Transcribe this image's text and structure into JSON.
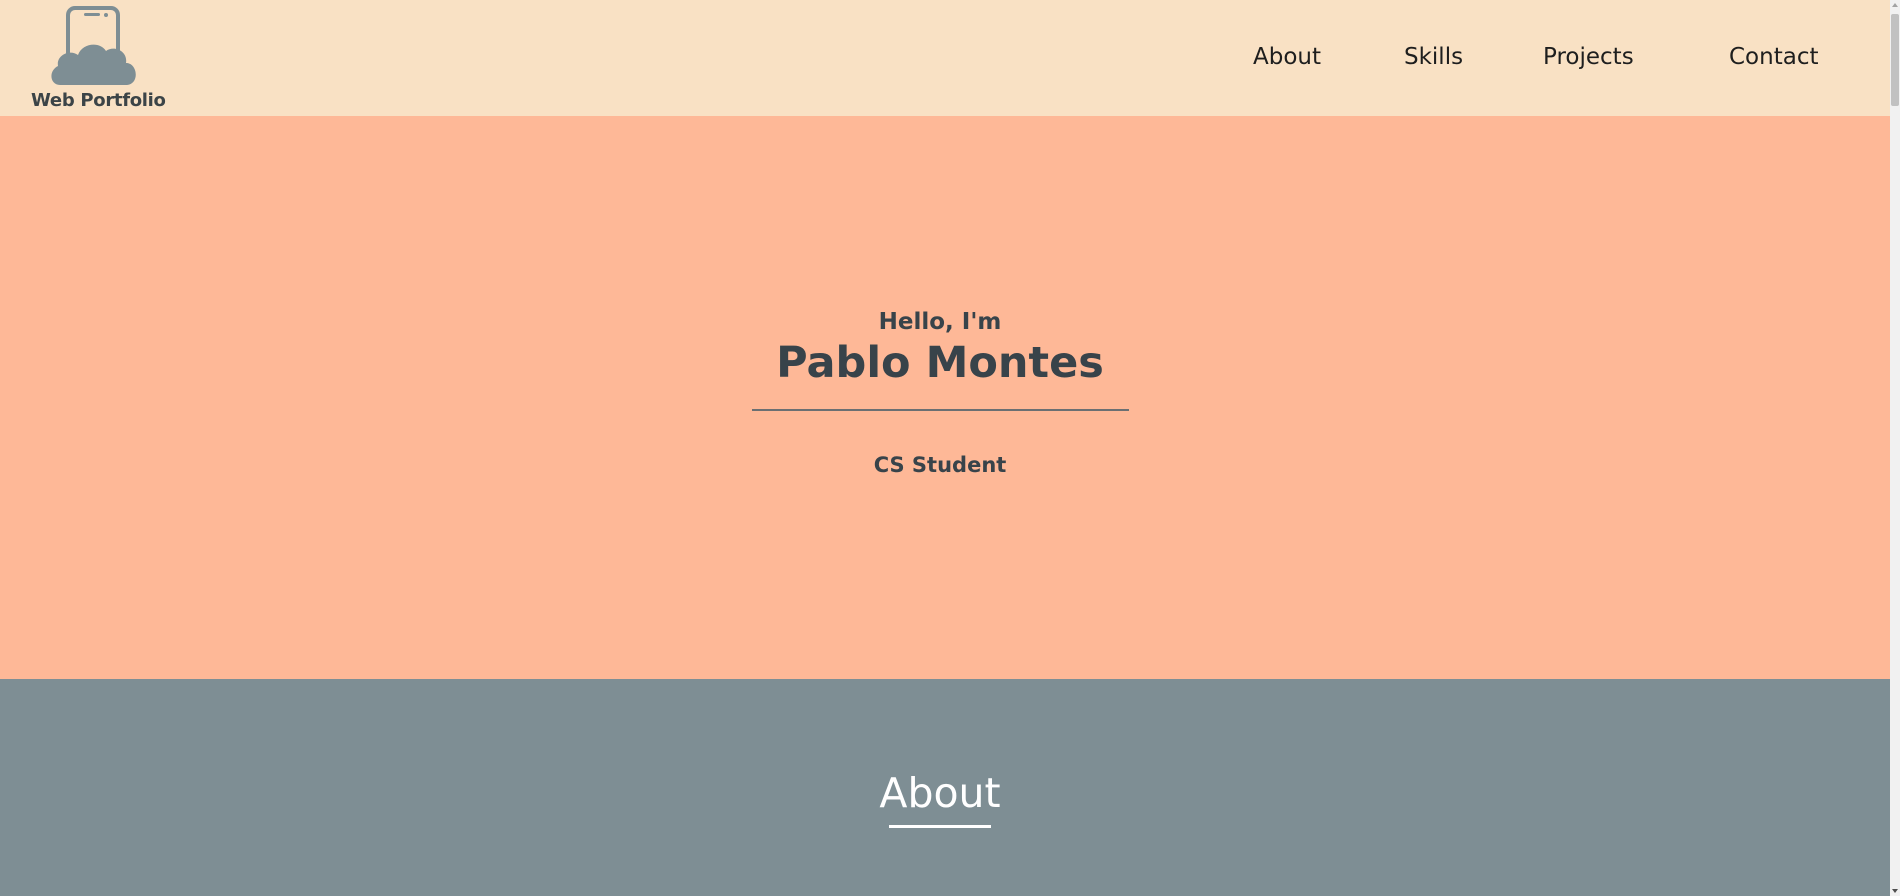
{
  "header": {
    "logo_text": "Web Portfolio",
    "logo_icon": "cloud-tablet-icon",
    "nav": [
      {
        "label": "About"
      },
      {
        "label": "Skills"
      },
      {
        "label": "Projects"
      },
      {
        "label": "Contact"
      }
    ]
  },
  "hero": {
    "greeting": "Hello, I'm",
    "name": "Pablo Montes",
    "role": "CS Student"
  },
  "about": {
    "title": "About"
  },
  "colors": {
    "header_bg": "#f9e1c4",
    "hero_bg": "#feb897",
    "about_bg": "#7e8e94",
    "text_dark": "#38434a",
    "logo_gray": "#7e8e94"
  }
}
